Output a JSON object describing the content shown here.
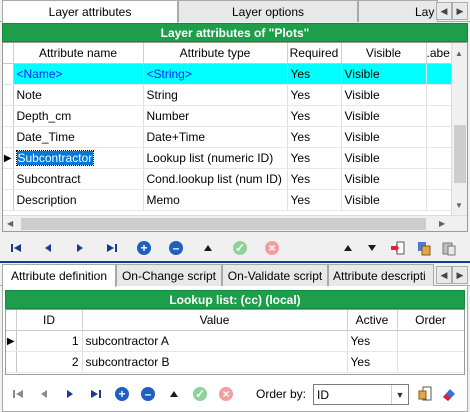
{
  "top_tabs": [
    "Layer attributes",
    "Layer options",
    "Lay"
  ],
  "layer_panel": {
    "title": "Layer attributes of \"Plots\"",
    "columns": [
      "Attribute name",
      "Attribute type",
      "Required",
      "Visible",
      ".abe"
    ],
    "rows": [
      {
        "name": "<Name>",
        "type": "<String>",
        "required": "Yes",
        "visible": "Visible"
      },
      {
        "name": "Note",
        "type": "String",
        "required": "Yes",
        "visible": "Visible"
      },
      {
        "name": "Depth_cm",
        "type": "Number",
        "required": "Yes",
        "visible": "Visible"
      },
      {
        "name": "Date_Time",
        "type": "Date+Time",
        "required": "Yes",
        "visible": "Visible"
      },
      {
        "name": "Subcontractor",
        "type": "Lookup list (numeric ID)",
        "required": "Yes",
        "visible": "Visible"
      },
      {
        "name": "Subcontract",
        "type": "Cond.lookup list (num ID)",
        "required": "Yes",
        "visible": "Visible"
      },
      {
        "name": "Description",
        "type": "Memo",
        "required": "Yes",
        "visible": "Visible"
      }
    ]
  },
  "bottom_tabs": [
    "Attribute definition",
    "On-Change script",
    "On-Validate script",
    "Attribute descripti"
  ],
  "lookup_panel": {
    "title": "Lookup list: (cc) (local)",
    "columns": [
      "ID",
      "Value",
      "Active",
      "Order"
    ],
    "rows": [
      {
        "id": "1",
        "value": "subcontractor A",
        "active": "Yes",
        "order": ""
      },
      {
        "id": "2",
        "value": "subcontractor B",
        "active": "Yes",
        "order": ""
      }
    ]
  },
  "order_by": {
    "label": "Order by:",
    "value": "ID"
  },
  "colors": {
    "title_green": "#1e9e4a",
    "highlight_cyan": "#00ffff",
    "selection_blue": "#0078d7",
    "nav_blue": "#1a3a8a"
  }
}
